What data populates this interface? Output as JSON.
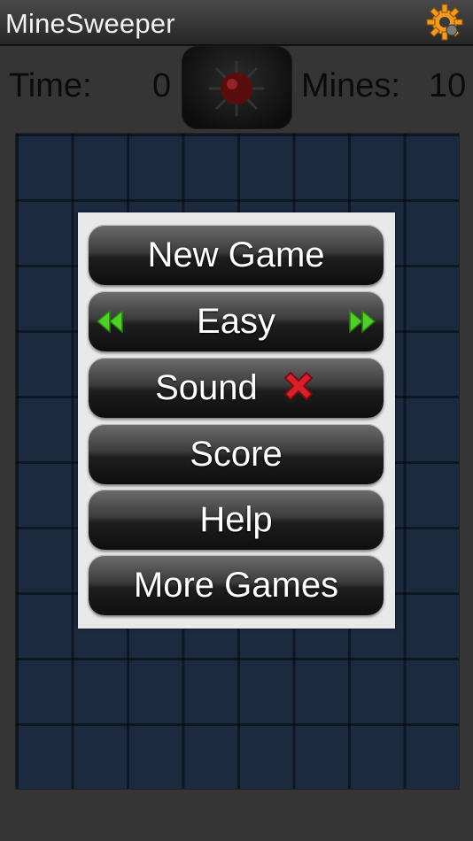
{
  "app": {
    "title": "MineSweeper"
  },
  "status": {
    "time_label": "Time:",
    "time_value": "0",
    "mines_label": "Mines:",
    "mines_value": "10"
  },
  "menu": {
    "new_game": "New Game",
    "difficulty": "Easy",
    "sound": "Sound",
    "sound_enabled": false,
    "score": "Score",
    "help": "Help",
    "more_games": "More Games"
  },
  "icons": {
    "settings": "gear-icon",
    "face": "mine-icon",
    "sound_state": "red-x-icon",
    "prev": "double-left-arrow-icon",
    "next": "double-right-arrow-icon"
  },
  "colors": {
    "board": "#1c2a40",
    "arrow_green": "#4fcf2a",
    "x_red": "#d8202c",
    "gear_orange": "#f09a1e"
  }
}
